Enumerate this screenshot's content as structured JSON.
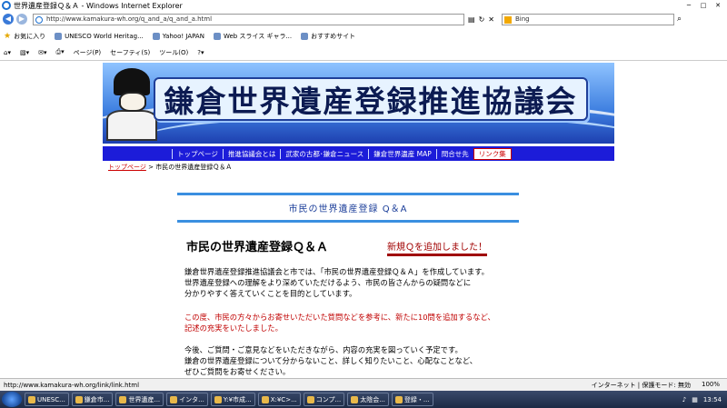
{
  "window": {
    "title": "世界遺産登録Ｑ＆Ａ - Windows Internet Explorer"
  },
  "address": {
    "url": "http://www.kamakura-wh.org/q_and_a/q_and_a.html",
    "search_placeholder": "Bing"
  },
  "favorites": {
    "label": "お気に入り",
    "items": [
      "UNESCO World Heritag...",
      "Yahoo! JAPAN",
      "Web スライス ギャラ...",
      "おすすめサイト"
    ]
  },
  "commands": {
    "items": [
      "ページ(P)",
      "セーフティ(S)",
      "ツール(O)"
    ]
  },
  "banner": {
    "title": "鎌倉世界遺産登録推進協議会"
  },
  "nav": {
    "items": [
      {
        "label": "トップページ"
      },
      {
        "label": "推進協議会とは"
      },
      {
        "label": "武家の古都･鎌倉ニュース"
      },
      {
        "label": "鎌倉世界遺産 MAP"
      },
      {
        "label": "問合せ先"
      },
      {
        "label": "リンク集"
      }
    ]
  },
  "breadcrumb": {
    "home": "トップページ",
    "current": "> 市民の世界遺産登録Ｑ＆Ａ"
  },
  "section": {
    "head": "市民の世界遺産登録 Q＆A",
    "title": "市民の世界遺産登録Ｑ＆Ａ",
    "badge": "新規Ｑを追加しました！",
    "para1": [
      "鎌倉世界遺産登録推進協議会と市では、「市民の世界遺産登録Ｑ＆Ａ」を作成しています。",
      "世界遺産登録への理解をより深めていただけるよう、市民の皆さんからの疑問などに",
      "分かりやすく答えていくことを目的としています。"
    ],
    "para2": [
      "この度、市民の方々からお寄せいただいた質問などを参考に、新たに10問を追加するなど、",
      "記述の充実をいたしました。"
    ],
    "para3": [
      "今後、ご質問・ご意見などをいただきながら、内容の充実を図っていく予定です。",
      "鎌倉の世界遺産登録について分からないこと、詳しく知りたいこと、心配なことなど、",
      "ぜひご質問をお寄せください。"
    ]
  },
  "status": {
    "url": "http://www.kamakura-wh.org/link/link.html",
    "zone": "インターネット | 保護モード: 無効",
    "zoom": "100%"
  },
  "taskbar": {
    "buttons": [
      "UNESC...",
      "鎌倉市...",
      "世界遺産...",
      "インタ...",
      "Y:¥市成...",
      "X:¥C>...",
      "コンプ...",
      "太陰会...",
      "登録・..."
    ],
    "clock": "13:54"
  }
}
